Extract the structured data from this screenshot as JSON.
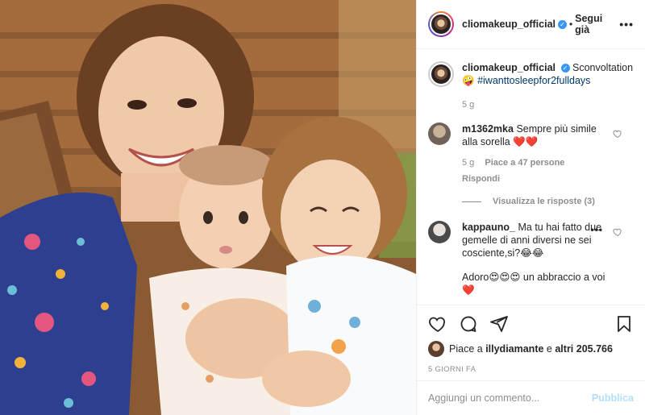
{
  "post": {
    "header": {
      "username": "cliomakeup_official",
      "follow_label": "Segui già",
      "separator": "•"
    },
    "caption": {
      "username": "cliomakeup_official",
      "text": "Sconvoltation",
      "emoji": "🤪",
      "hashtag": "#iwanttosleepfor2fulldays",
      "time": "5 g"
    },
    "comments": [
      {
        "username": "m1362mka",
        "text": "Sempre più simile alla sorella ❤️❤️",
        "time": "5 g",
        "likes": "Piace a 47 persone",
        "reply": "Rispondi",
        "view_replies": "Visualizza le risposte (3)"
      },
      {
        "username": "kappauno_",
        "text": "Ma tu hai fatto due gemelle di anni diversi ne sei cosciente,si?😂😂",
        "more": "•••"
      }
    ],
    "extra_text": "Adoro😍😍😍 un abbraccio a voi❤️",
    "likes": {
      "prefix": "Piace a",
      "user": "illydiamante",
      "connector": "e",
      "others": "altri 205.766"
    },
    "date": "5 GIORNI FA",
    "add_comment_placeholder": "Aggiungi un commento...",
    "publish_label": "Pubblica",
    "icons": {
      "like": "heart-icon",
      "comment": "comment-icon",
      "share": "paper-plane-icon",
      "save": "bookmark-icon",
      "more": "more-options-icon"
    },
    "colors": {
      "link": "#00376b",
      "verified": "#3897f0",
      "publish_disabled": "#b2dffc",
      "muted": "#8e8e8e"
    }
  }
}
